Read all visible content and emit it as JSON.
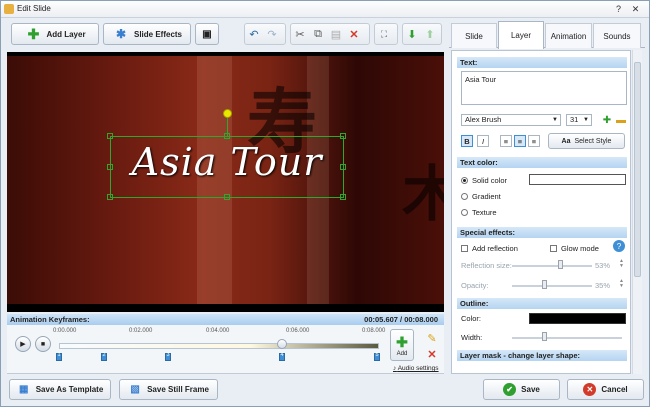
{
  "window": {
    "title": "Edit Slide"
  },
  "toolbar": {
    "add_layer": "Add Layer",
    "slide_effects": "Slide Effects"
  },
  "preview": {
    "caption": "Asia Tour"
  },
  "keyframes": {
    "title": "Animation Keyframes:",
    "current_time": "00:05.607",
    "total_time": "00:08.000",
    "ticks": [
      "0:00.000",
      "0:02.000",
      "0:04.000",
      "0:06.000",
      "0:08.000"
    ],
    "markers": [
      "1",
      "2",
      "3",
      "4",
      "5"
    ],
    "add_label": "Add",
    "audio_settings": "Audio settings"
  },
  "tabs": [
    "Slide",
    "Layer",
    "Animation",
    "Sounds"
  ],
  "active_tab": "Layer",
  "layer": {
    "text_header": "Text:",
    "text_value": "Asia Tour",
    "font": "Alex Brush",
    "font_size": "31",
    "select_style": "Select Style",
    "text_color_header": "Text color:",
    "solid_color": "Solid color",
    "gradient": "Gradient",
    "texture": "Texture",
    "special_effects_header": "Special effects:",
    "add_reflection": "Add reflection",
    "glow_mode": "Glow mode",
    "reflection_size_label": "Reflection size:",
    "reflection_size_value": "53%",
    "opacity_label": "Opacity:",
    "opacity_value": "35%",
    "outline_header": "Outline:",
    "color_label": "Color:",
    "width_label": "Width:",
    "layer_mask_header": "Layer mask - change layer shape:"
  },
  "bottom": {
    "save_template": "Save As Template",
    "save_still": "Save Still Frame",
    "save": "Save",
    "cancel": "Cancel"
  },
  "colors": {
    "accent": "#3f8fd6",
    "selection": "#2da82d",
    "solid_color_swatch": "#ffffff",
    "outline_color": "#000000"
  }
}
